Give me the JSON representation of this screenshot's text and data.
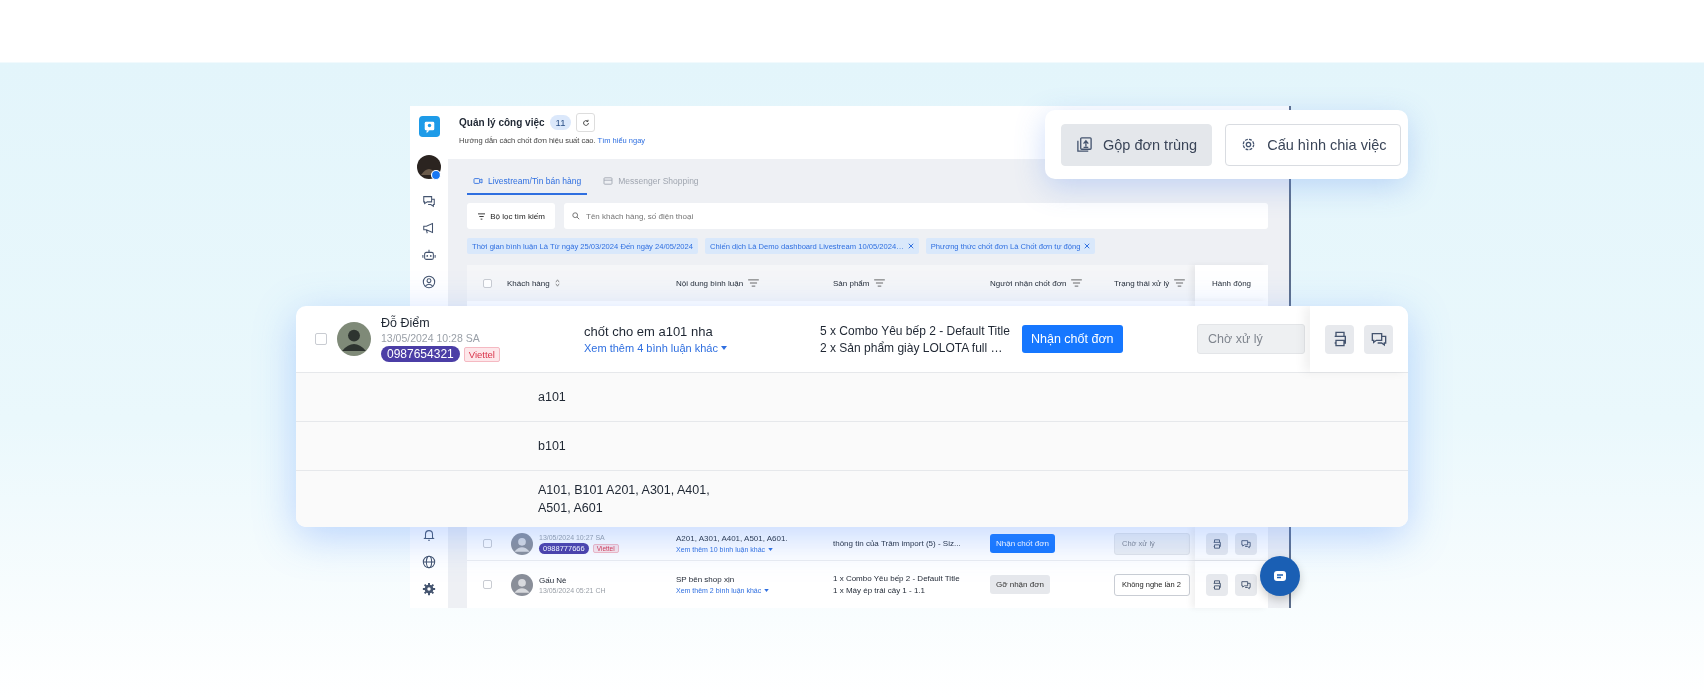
{
  "header": {
    "title": "Quản lý công việc",
    "count": "11",
    "hint": "Hướng dẫn cách chốt đơn hiệu suất cao.",
    "hint_link": "Tìm hiểu ngay"
  },
  "top_actions": [
    {
      "label": "Gộp đơn trùng",
      "kind": "merge",
      "selected": true
    },
    {
      "label": "Cấu hình chia việc",
      "kind": "settings",
      "selected": false
    }
  ],
  "tabs": [
    {
      "label": "Livestream/Tin bán hàng",
      "kind": "video",
      "selected": true
    },
    {
      "label": "Messenger Shopping",
      "kind": "shop",
      "selected": false
    }
  ],
  "filter_button": "Bộ lọc tìm kiếm",
  "search": {
    "placeholder": "Tên khách hàng, số điện thoại"
  },
  "filters": [
    {
      "label": "Thời gian bình luận Là Từ ngày 25/03/2024 Đến ngày 24/05/2024",
      "removable": false
    },
    {
      "label": "Chiến dịch Là Demo dashboard Livestream 10/05/2024…",
      "removable": true
    },
    {
      "label": "Phương thức chốt đơn Là Chốt đơn tự động",
      "removable": true
    }
  ],
  "table": {
    "select_all": {
      "checked": false
    },
    "columns": [
      {
        "label": "Khách hàng",
        "kind": "sort"
      },
      {
        "label": "Nội dung bình luận",
        "kind": "filter"
      },
      {
        "label": "Sản phẩm",
        "kind": "filter"
      },
      {
        "label": "Người nhận chốt đơn",
        "kind": "filter"
      },
      {
        "label": "Trạng thái xử lý",
        "kind": "filter"
      },
      {
        "label": "Hành động",
        "kind": "plain"
      }
    ],
    "rows": [
      {
        "checked": false,
        "time": "13/05/2024 10:27 SA",
        "phone": "0988777666",
        "carrier": "Viettel",
        "comment": "A201, A301, A401, A501, A601.",
        "more": "Xem thêm 10 bình luận khác",
        "products": [
          "thông tin của Trâm import (5) - Siz..."
        ],
        "action": {
          "label": "Nhận chốt đơn",
          "kind": "primary"
        },
        "status": {
          "placeholder": "Chờ xử lý",
          "disabled": true
        }
      },
      {
        "checked": false,
        "name": "Gấu Nè",
        "time": "13/05/2024 05:21 CH",
        "comment": "SP bên shop xịn",
        "more": "Xem thêm 2 bình luận khác",
        "products": [
          "1 x Combo Yêu bếp 2 - Default Title",
          "1 x Máy ép trái cây 1 - 1.1"
        ],
        "action": {
          "label": "Gỡ nhận đơn",
          "kind": "secondary"
        },
        "status": {
          "value": "Không nghe lần 2",
          "disabled": false
        }
      }
    ]
  },
  "expanded_order": {
    "checked": false,
    "name": "Đỗ Điểm",
    "time": "13/05/2024 10:28 SA",
    "phone": "0987654321",
    "carrier": "Viettel",
    "comment": "chốt cho em a101 nha",
    "more": "Xem thêm 4 bình luận khác",
    "products": [
      "5 x Combo Yêu bếp 2 - Default Title",
      "2 x Sản phẩm giày LOLOTA full …"
    ],
    "action": {
      "label": "Nhận chốt đơn",
      "kind": "primary"
    },
    "status": {
      "placeholder": "Chờ xử lý",
      "disabled": true
    },
    "sub_comments": [
      "a101",
      "b101",
      "A101, B101 A201, A301, A401, A501, A601"
    ]
  }
}
